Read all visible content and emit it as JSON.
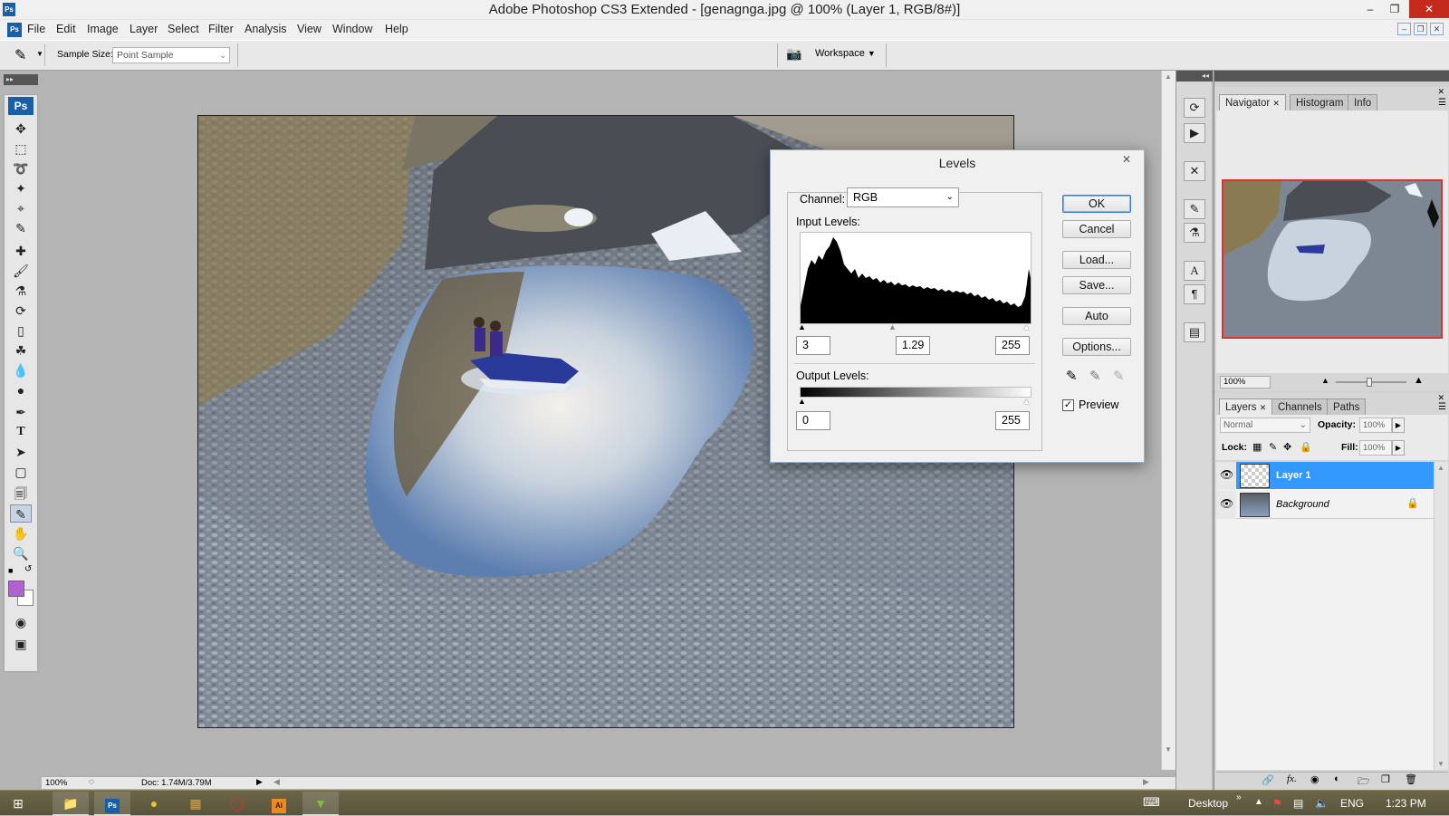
{
  "app": {
    "title": "Adobe Photoshop CS3 Extended - [genagnga.jpg @ 100% (Layer 1, RGB/8#)]",
    "logo": "Ps"
  },
  "menu": [
    "File",
    "Edit",
    "Image",
    "Layer",
    "Select",
    "Filter",
    "Analysis",
    "View",
    "Window",
    "Help"
  ],
  "options": {
    "sample_size_label": "Sample Size:",
    "sample_size_value": "Point Sample",
    "workspace_label": "Workspace"
  },
  "toolbox": {
    "logo": "Ps",
    "tools": [
      "move",
      "marquee",
      "lasso",
      "magic-wand",
      "crop",
      "slice",
      "healing",
      "brush",
      "clone-stamp",
      "history-brush",
      "eraser",
      "paint-bucket",
      "blur",
      "dodge",
      "pen",
      "type",
      "path-select",
      "shape",
      "notes",
      "eyedropper",
      "hand",
      "zoom"
    ],
    "selected_tool": "eyedropper",
    "foreground_color": "#b060d0",
    "background_color": "#ffffff"
  },
  "status": {
    "zoom": "100%",
    "doc": "Doc: 1.74M/3.79M"
  },
  "levels": {
    "title": "Levels",
    "channel_label": "Channel:",
    "channel_value": "RGB",
    "input_label": "Input Levels:",
    "input_black": "3",
    "input_gamma": "1.29",
    "input_white": "255",
    "output_label": "Output Levels:",
    "output_black": "0",
    "output_white": "255",
    "buttons": {
      "ok": "OK",
      "cancel": "Cancel",
      "load": "Load...",
      "save": "Save...",
      "auto": "Auto",
      "options": "Options..."
    },
    "preview_label": "Preview",
    "preview_checked": true
  },
  "navigator": {
    "tabs": [
      "Navigator",
      "Histogram",
      "Info"
    ],
    "zoom": "100%"
  },
  "layers": {
    "tabs": [
      "Layers",
      "Channels",
      "Paths"
    ],
    "blend_mode": "Normal",
    "opacity_label": "Opacity:",
    "opacity": "100%",
    "lock_label": "Lock:",
    "fill_label": "Fill:",
    "fill": "100%",
    "items": [
      {
        "name": "Layer 1",
        "selected": true,
        "locked": false
      },
      {
        "name": "Background",
        "selected": false,
        "locked": true
      }
    ]
  },
  "taskbar": {
    "desktop_label": "Desktop",
    "lang": "ENG",
    "time": "1:23 PM"
  },
  "colors": {
    "selection": "#3399ff",
    "accent": "#1a5ea8"
  }
}
